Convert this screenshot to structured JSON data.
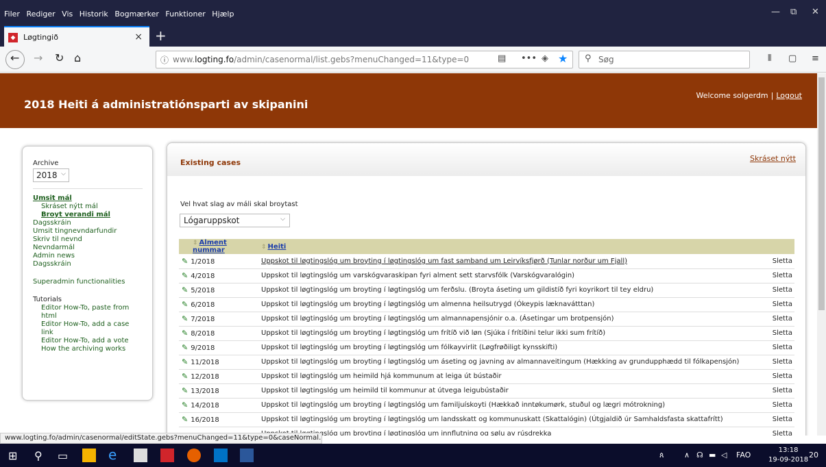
{
  "menubar": {
    "items": [
      "Filer",
      "Rediger",
      "Vis",
      "Historik",
      "Bogmærker",
      "Funktioner",
      "Hjælp"
    ]
  },
  "window_controls": {
    "minimize": "—",
    "restore": "⧉",
    "close": "✕"
  },
  "tab": {
    "title": "Løgtingið",
    "close": "×",
    "new_tab": "+"
  },
  "nav": {
    "url_prefix": "www.",
    "url_host": "logting.fo",
    "url_path": "/admin/casenormal/list.gebs?menuChanged=11&type=0",
    "search_placeholder": "Søg"
  },
  "banner": {
    "heading": "2018  Heiti á administratiónsparti av skipanini",
    "welcome": "Welcome solgerdm",
    "separator": "|",
    "logout": "Logout"
  },
  "sidebar": {
    "archive_label": "Archive",
    "year": "2018",
    "menu": {
      "umsit_mal": "Umsit mál",
      "skraset_nytt_mal": "Skráset nýtt mál",
      "broyt_verandi_mal": "Broyt verandi mál",
      "dagsskrain": "Dagsskráin",
      "umsit_tingnevndarfundir": "Umsit tingnevndarfundir",
      "skriv_til_nevnd": "Skriv til nevnd",
      "nevndarmal": "Nevndarmál",
      "admin_news": "Admin news",
      "dagsskrain2": "Dagsskráin",
      "superadmin": "Superadmin functionalities",
      "tutorials": "Tutorials",
      "tut1": "Editor How-To, paste from html",
      "tut2": "Editor How-To, add a case link",
      "tut3": "Editor How-To, add a vote",
      "tut4": "How the archiving works"
    }
  },
  "main": {
    "section_title": "Existing cases",
    "register_new": "Skráset nýtt",
    "kind_label": "Vel hvat slag av máli skal broytast",
    "kind_selected": "Lógaruppskot",
    "columns": {
      "number": "Alment nummar",
      "title": "Heiti"
    },
    "delete_label": "Sletta",
    "rows": [
      {
        "number": "1/2018",
        "title": "Uppskot til løgtingslóg um broyting í løgtingslóg um fast samband um Leirvíksfjørð (Tunlar norður um Fjall)"
      },
      {
        "number": "4/2018",
        "title": "Uppskot til løgtingslóg um varskógvaraskipan fyri alment sett starvsfólk (Varskógvaralógin)"
      },
      {
        "number": "5/2018",
        "title": "Uppskot til løgtingslóg um broyting í løgtingslóg um ferðslu. (Broyta áseting um gildistíð fyri koyrikort til tey eldru)"
      },
      {
        "number": "6/2018",
        "title": "Uppskot til løgtingslóg um broyting í løgtingslóg um almenna heilsutrygd (Ókeypis læknavátttan)"
      },
      {
        "number": "7/2018",
        "title": "Uppskot til løgtingslóg um broyting í løgtingslóg um almannapensjónir o.a. (Ásetingar um brotpensjón)"
      },
      {
        "number": "8/2018",
        "title": "Uppskot til løgtingslóg um broyting í løgtingslóg um frítíð við løn (Sjúka í frítíðini telur ikki sum frítíð)"
      },
      {
        "number": "9/2018",
        "title": "Uppskot til løgtingslóg um broyting í løgtingslóg um fólkayvirlit (Løgfrøðiligt kynsskifti)"
      },
      {
        "number": "11/2018",
        "title": "Uppskot til løgtingslóg um broyting í løgtingslóg um áseting og javning av almannaveitingum (Hækking av grundupphædd til fólkapensjón)"
      },
      {
        "number": "12/2018",
        "title": "Uppskot til løgtingslóg um heimild hjá kommunum at leiga út bústaðir"
      },
      {
        "number": "13/2018",
        "title": "Uppskot til løgtingslóg um heimild til kommunur at útvega leigubústaðir"
      },
      {
        "number": "14/2018",
        "title": "Uppskot til løgtingslóg um broyting í løgtingslóg um familjuískoyti (Hækkað inntøkumørk, stuðul og lægri mótrokning)"
      },
      {
        "number": "16/2018",
        "title": "Uppskot til løgtingslóg um broyting í løgtingslóg um landsskatt og kommunuskatt (Skattalógin) (Útgjaldið úr Samhaldsfasta skattafrítt)"
      },
      {
        "number": "",
        "title": "Uppskot til løgtingslóg um broyting í løgtingslóg um innflutning og sølu av rúsdrekka"
      }
    ]
  },
  "statusbar": {
    "url": "www.logting.fo/admin/casenormal/editState.gebs?menuChanged=11&type=0&caseNormal.id=4090"
  },
  "taskbar": {
    "lang": "FAO",
    "time": "13:18",
    "date": "19-09-2018",
    "notifications": "20"
  }
}
